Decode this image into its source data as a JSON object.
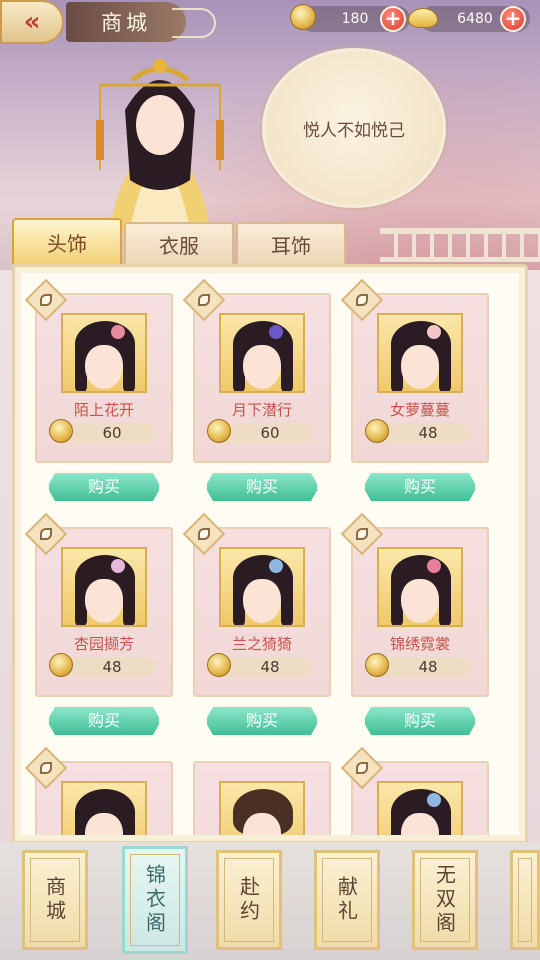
{
  "header": {
    "title": "商城",
    "coins": "180",
    "ingots": "6480"
  },
  "quote": "悦人不如悦己",
  "tabs": [
    {
      "label": "头饰",
      "active": true
    },
    {
      "label": "衣服",
      "active": false
    },
    {
      "label": "耳饰",
      "active": false
    }
  ],
  "items": [
    {
      "name": "陌上花开",
      "price": "60",
      "buy": "购买"
    },
    {
      "name": "月下潜行",
      "price": "60",
      "buy": "购买"
    },
    {
      "name": "女萝蔓蔓",
      "price": "48",
      "buy": "购买"
    },
    {
      "name": "杏园撷芳",
      "price": "48",
      "buy": "购买"
    },
    {
      "name": "兰之猗猗",
      "price": "48",
      "buy": "购买"
    },
    {
      "name": "锦绣霓裳",
      "price": "48",
      "buy": "购买"
    }
  ],
  "bottom_nav": [
    {
      "label": "商城",
      "active": false
    },
    {
      "label": "锦衣阁",
      "active": true
    },
    {
      "label": "赴约",
      "active": false
    },
    {
      "label": "献礼",
      "active": false
    },
    {
      "label": "无双阁",
      "active": false
    }
  ],
  "colors": {
    "accent_gold": "#f2cf74",
    "buy_green": "#3fbf97",
    "name_red": "#c6534a"
  }
}
